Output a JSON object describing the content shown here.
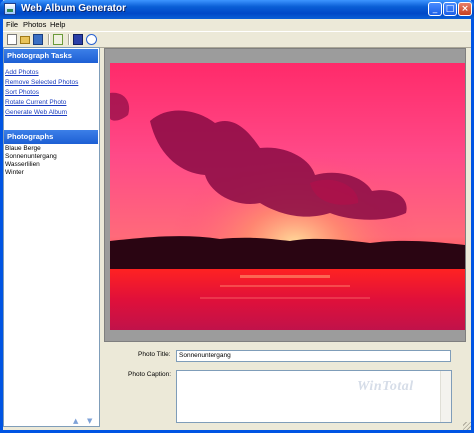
{
  "window": {
    "title": "Web Album Generator",
    "controls": {
      "minimize": "_",
      "maximize": "□",
      "close": "×"
    }
  },
  "menu": [
    {
      "label": "File"
    },
    {
      "label": "Photos"
    },
    {
      "label": "Help"
    }
  ],
  "toolbar": {
    "icons": [
      "new-document-icon",
      "open-folder-icon",
      "save-icon",
      "view-icon",
      "help-book-icon",
      "info-icon"
    ]
  },
  "tasks_panel": {
    "header": "Photograph Tasks",
    "items": [
      "Add Photos",
      "Remove Selected Photos",
      "Sort Photos",
      "Rotate Current Photo",
      "Generate Web Album"
    ]
  },
  "photos_panel": {
    "header": "Photographs",
    "items": [
      "Blaue Berge",
      "Sonnenuntergang",
      "Wasserlilien",
      "Winter"
    ],
    "nav_up": "▲",
    "nav_down": "▼"
  },
  "details": {
    "photo_title_label": "Photo Title:",
    "photo_title_value": "Sonnenuntergang",
    "photo_caption_label": "Photo Caption:",
    "caption_value": "",
    "watermark": "WinTotal"
  },
  "colors": {
    "titlebar": "#0a5fd6",
    "pane_header": "#2a6ee0",
    "link": "#1a3cbf",
    "preview_background": "#9c9c9c"
  }
}
